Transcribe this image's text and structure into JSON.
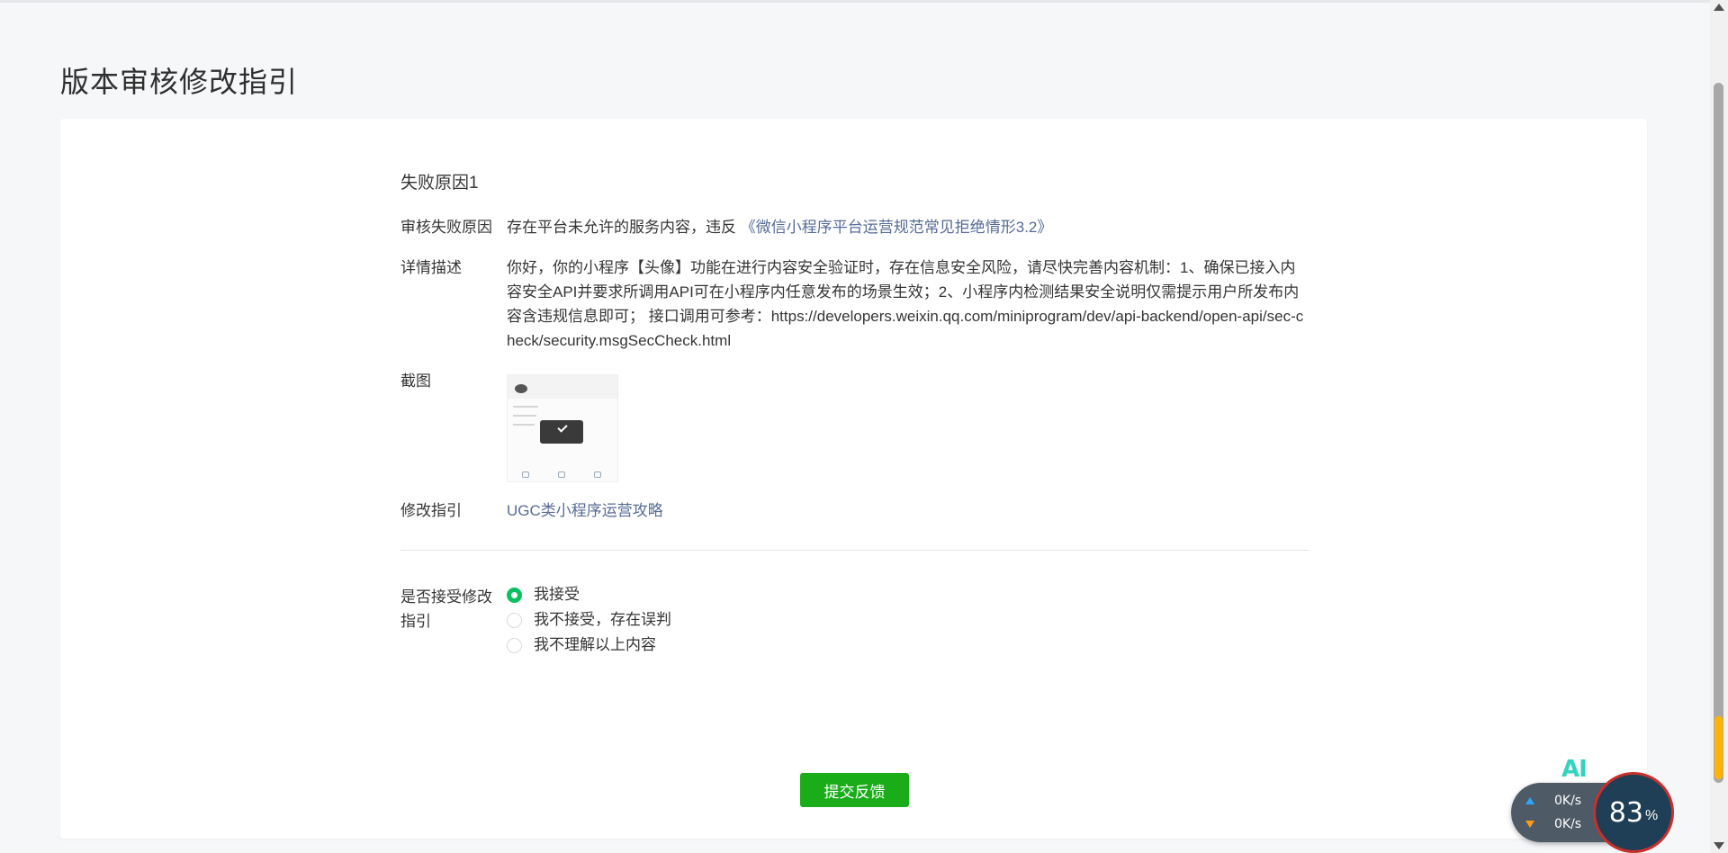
{
  "page": {
    "title": "版本审核修改指引"
  },
  "failure": {
    "section_title": "失败原因1",
    "reason_label": "审核失败原因",
    "reason_text": "存在平台未允许的服务内容，违反",
    "reason_link": "《微信小程序平台运营规范常见拒绝情形3.2》",
    "detail_label": "详情描述",
    "detail_text": "你好，你的小程序【头像】功能在进行内容安全验证时，存在信息安全风险，请尽快完善内容机制：1、确保已接入内容安全API并要求所调用API可在小程序内任意发布的场景生效；2、小程序内检测结果安全说明仅需提示用户所发布内容含违规信息即可； 接口调用可参考：https://developers.weixin.qq.com/miniprogram/dev/api-backend/open-api/sec-check/security.msgSecCheck.html",
    "screenshot_label": "截图",
    "guide_label": "修改指引",
    "guide_link": "UGC类小程序运营攻略"
  },
  "accept": {
    "label": "是否接受修改指引",
    "options": [
      {
        "label": "我接受",
        "checked": true
      },
      {
        "label": "我不接受，存在误判",
        "checked": false
      },
      {
        "label": "我不理解以上内容",
        "checked": false
      }
    ]
  },
  "submit_label": "提交反馈",
  "overlay": {
    "ai_label": "AI",
    "upload_speed": "0K/s",
    "download_speed": "0K/s",
    "cpu_value": "83",
    "cpu_unit": "%"
  },
  "colors": {
    "link": "#576b95",
    "primary_green": "#1aad19",
    "radio_green": "#07c160"
  }
}
